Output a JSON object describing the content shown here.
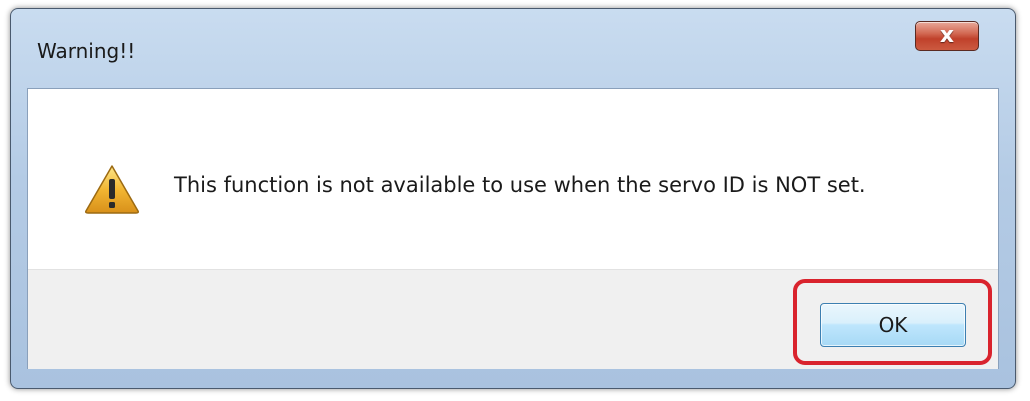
{
  "window": {
    "title": "Warning!!",
    "close_icon": "close-icon",
    "close_glyph": "x"
  },
  "message": {
    "icon": "warning-icon",
    "text": "This function is not available to use when the servo ID is NOT set."
  },
  "buttons": {
    "ok_label": "OK"
  },
  "colors": {
    "highlight": "#d9232d",
    "close_button": "#c0412b",
    "warning_fill": "#f2b632"
  }
}
